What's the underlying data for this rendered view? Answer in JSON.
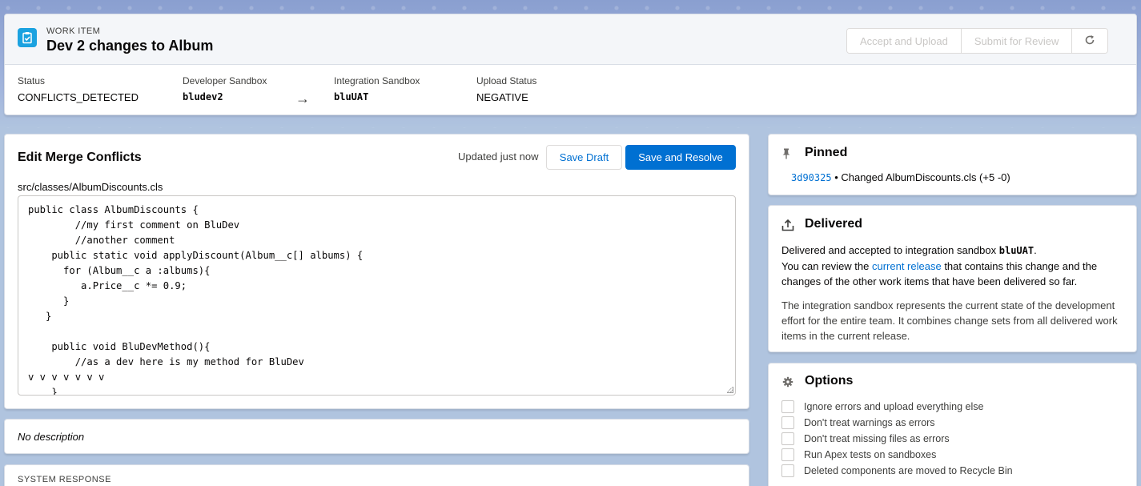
{
  "header": {
    "label": "WORK ITEM",
    "title": "Dev 2 changes to Album",
    "buttons": {
      "accept_upload": "Accept and Upload",
      "submit_review": "Submit for Review"
    },
    "fields": {
      "status_label": "Status",
      "status_value": "CONFLICTS_DETECTED",
      "dev_sandbox_label": "Developer Sandbox",
      "dev_sandbox_value": "bludev2",
      "int_sandbox_label": "Integration Sandbox",
      "int_sandbox_value": "bluUAT",
      "upload_status_label": "Upload Status",
      "upload_status_value": "NEGATIVE"
    }
  },
  "merge": {
    "title": "Edit Merge Conflicts",
    "updated_text": "Updated just now",
    "save_draft": "Save Draft",
    "save_resolve": "Save and Resolve",
    "file_path": "src/classes/AlbumDiscounts.cls",
    "code_lines": [
      "public class AlbumDiscounts {",
      "        //my first comment on BluDev",
      "        //another comment",
      "    public static void applyDiscount(Album__c[] albums) {",
      "      for (Album__c a :albums){",
      "         a.Price__c *= 0.9;",
      "      }",
      "   }",
      "",
      "    public void BluDevMethod(){",
      "        //as a dev here is my method for BluDev",
      "v v v v v v v",
      "    }"
    ]
  },
  "description": {
    "text": "No description"
  },
  "system_response": {
    "label": "SYSTEM RESPONSE"
  },
  "pinned": {
    "title": "Pinned",
    "commit_hash": "3d90325",
    "commit_text": " • Changed AlbumDiscounts.cls (+5 -0)"
  },
  "delivered": {
    "title": "Delivered",
    "line1_prefix": "Delivered and accepted to integration sandbox ",
    "line1_sandbox": "bluUAT",
    "line1_suffix": ".",
    "line2_prefix": "You can review the ",
    "line2_link": "current release",
    "line2_suffix": " that contains this change and the changes of the other work items that have been delivered so far.",
    "para2": "The integration sandbox represents the current state of the development effort for the entire team. It combines change sets from all delivered work items in the current release."
  },
  "options": {
    "title": "Options",
    "items": [
      "Ignore errors and upload everything else",
      "Don't treat warnings as errors",
      "Don't treat missing files as errors",
      "Run Apex tests on sandboxes",
      "Deleted components are moved to Recycle Bin"
    ]
  },
  "colors": {
    "brand": "#0070d2",
    "work_item_icon": "#1ba2e0"
  },
  "icons": {
    "work_item": "clipboard-check-icon",
    "refresh": "refresh-icon",
    "arrow": "arrow-right-icon",
    "pin": "pin-icon",
    "upload": "upload-icon",
    "gear": "gear-icon"
  }
}
